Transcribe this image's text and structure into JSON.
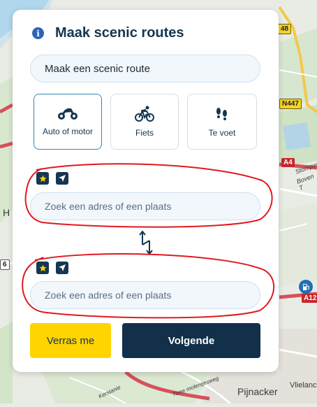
{
  "panel": {
    "title": "Maak scenic routes",
    "route_name_value": "Maak een scenic route"
  },
  "modes": [
    {
      "label": "Auto of motor",
      "icon": "motorcycle-icon",
      "active": true
    },
    {
      "label": "Fiets",
      "icon": "bicycle-icon",
      "active": false
    },
    {
      "label": "Te voet",
      "icon": "footprints-icon",
      "active": false
    }
  ],
  "waypoints": [
    {
      "placeholder": "Zoek een adres of een plaats",
      "icons": [
        "star-icon",
        "location-arrow-icon"
      ]
    },
    {
      "placeholder": "Zoek een adres of een plaats",
      "icons": [
        "star-icon",
        "location-arrow-icon"
      ]
    }
  ],
  "buttons": {
    "surprise": "Verras me",
    "next": "Volgende"
  },
  "map": {
    "labels": {
      "pijnacker": "Pijnacker",
      "h_label": "H",
      "vliela": "Vlielanc",
      "stompwijk": "Stompwijk",
      "boven_t": "Boven T",
      "weg1": "Twee molentjesweg",
      "weg2": "Kerstanie"
    },
    "shields": {
      "n447": "N447",
      "n48": "48",
      "a4": "A4",
      "a12": "A12",
      "n6": "6"
    }
  },
  "colors": {
    "accent_blue": "#2f87b8",
    "dark_navy": "#12304a",
    "yellow": "#ffd400"
  }
}
